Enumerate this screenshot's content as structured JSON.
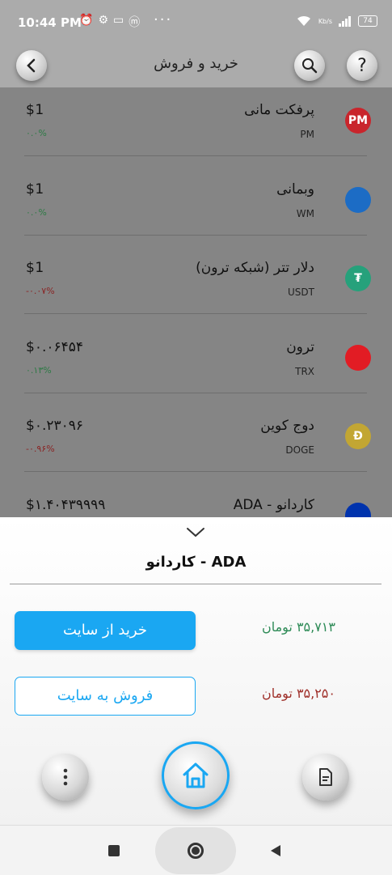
{
  "status_bar": {
    "time": "10:44 PM",
    "dots": "···",
    "battery": "74",
    "network": "Kb/s"
  },
  "header": {
    "title": "خرید و فروش",
    "back_icon": "chevron-left-icon",
    "search_icon": "search-icon",
    "help_label": "?"
  },
  "coins": [
    {
      "name": "پرفکت مانی",
      "code": "PM",
      "price": "$1",
      "change": "۰.۰%",
      "trend": "up",
      "icon_text": "PM",
      "icon_color": "#c9252c"
    },
    {
      "name": "وبمانی",
      "code": "WM",
      "price": "$1",
      "change": "۰.۰%",
      "trend": "up",
      "icon_text": "",
      "icon_color": "#1c6cc5"
    },
    {
      "name": "دلار تتر (شبکه ترون)",
      "code": "USDT",
      "price": "$1",
      "change": "-۰.۰۷%",
      "trend": "down",
      "icon_text": "₮",
      "icon_color": "#26a17b"
    },
    {
      "name": "ترون",
      "code": "TRX",
      "price": "$۰.۰۶۴۵۴",
      "change": "۰.۱۳%",
      "trend": "up",
      "icon_text": "",
      "icon_color": "#e21c24"
    },
    {
      "name": "دوج کوین",
      "code": "DOGE",
      "price": "$۰.۲۳۰۹۶",
      "change": "-۰.۹۶%",
      "trend": "down",
      "icon_text": "Ð",
      "icon_color": "#c2a633"
    },
    {
      "name": "کاردانو - ADA",
      "code": "ADA",
      "price": "$۱.۴۰۴۳۹۹۹۹",
      "change": "",
      "trend": "up",
      "icon_text": "",
      "icon_color": "#0033ad"
    }
  ],
  "sheet": {
    "title": "کاردانو - ADA",
    "buy_price": "۳۵,۷۱۳ تومان",
    "sell_price": "۳۵,۲۵۰ تومان",
    "buy_label": "خرید از سایت",
    "sell_label": "فروش به سایت"
  },
  "colors": {
    "accent": "#1aa7f2",
    "buy": "#2e8b57",
    "sell": "#a0312b"
  }
}
